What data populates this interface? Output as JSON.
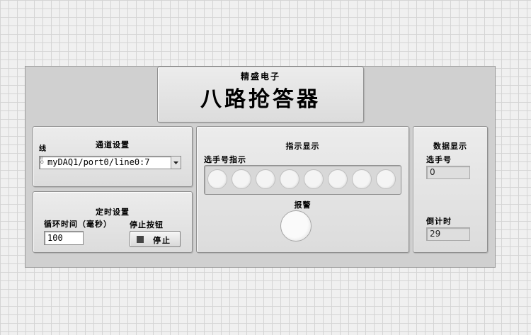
{
  "header": {
    "subtitle": "精盛电子",
    "title": "八路抢答器"
  },
  "channel": {
    "heading": "通道设置",
    "line_label": "线",
    "prefix_glyph": "I/O",
    "value": "myDAQ1/port0/line0:7",
    "dropdown_icon": "triangle-down"
  },
  "timer": {
    "heading": "定时设置",
    "loop_label": "循环时间（毫秒）",
    "loop_value": "100",
    "stop_label": "停止按钮",
    "stop_button": "停止"
  },
  "indicator": {
    "heading": "指示显示",
    "player_label": "选手号指示",
    "leds": [
      false,
      false,
      false,
      false,
      false,
      false,
      false,
      false
    ],
    "alarm_label": "报警",
    "alarm_on": false
  },
  "data_display": {
    "heading": "数据显示",
    "player_label": "选手号",
    "player_value": "0",
    "countdown_label": "倒计时",
    "countdown_value": "29"
  }
}
